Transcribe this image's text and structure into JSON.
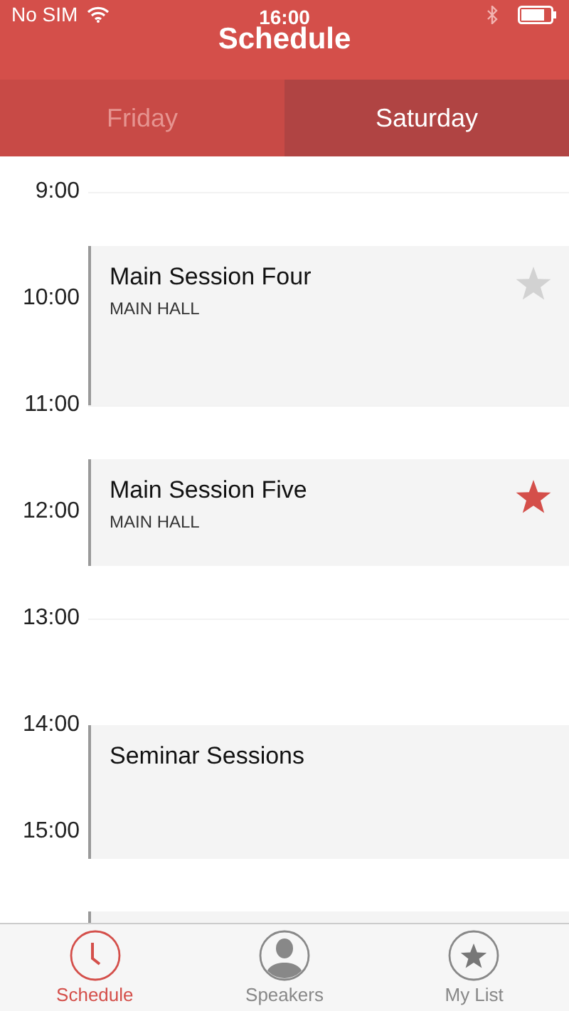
{
  "status_bar": {
    "carrier": "No SIM",
    "time": "16:00"
  },
  "title": "Schedule",
  "day_tabs": [
    {
      "label": "Friday",
      "selected": false
    },
    {
      "label": "Saturday",
      "selected": true
    }
  ],
  "timeline": {
    "hours": [
      "9:00",
      "10:00",
      "11:00",
      "12:00",
      "13:00",
      "14:00",
      "15:00"
    ],
    "events": [
      {
        "kind": "session",
        "title": "Main Session Four",
        "location": "MAIN HALL",
        "starred": false
      },
      {
        "kind": "session",
        "title": "Main Session Five",
        "location": "MAIN HALL",
        "starred": true
      },
      {
        "kind": "session",
        "title": "Seminar Sessions"
      },
      {
        "kind": "session"
      }
    ]
  },
  "tab_bar": [
    {
      "label": "Schedule",
      "kind": "clock",
      "selected": true
    },
    {
      "label": "Speakers",
      "kind": "person",
      "selected": false
    },
    {
      "label": "My List",
      "kind": "star",
      "selected": false
    }
  ]
}
